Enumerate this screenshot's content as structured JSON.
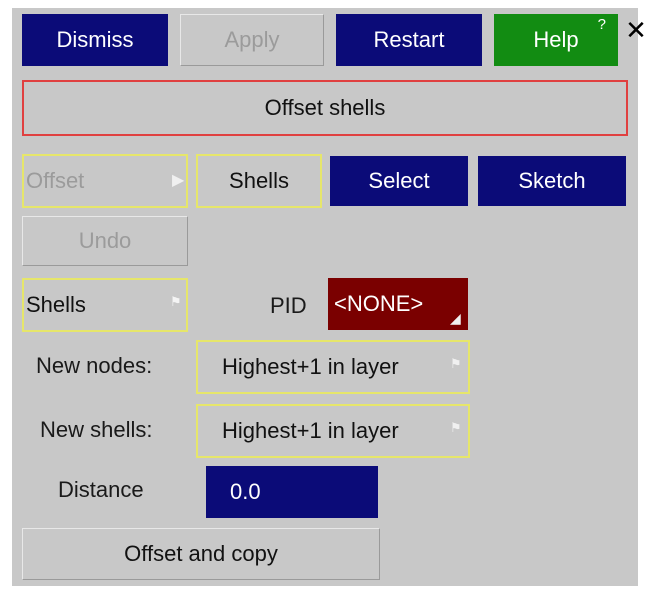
{
  "toolbar": {
    "dismiss": "Dismiss",
    "apply": "Apply",
    "restart": "Restart",
    "help": "Help",
    "help_badge": "?",
    "close": "✕"
  },
  "title": "Offset shells",
  "mode_row": {
    "offset": "Offset",
    "shells": "Shells",
    "select": "Select",
    "sketch": "Sketch"
  },
  "undo": "Undo",
  "shells_row": {
    "shells": "Shells",
    "pid_label": "PID",
    "pid_value": "<NONE>"
  },
  "new_nodes": {
    "label": "New nodes:",
    "value": "Highest+1 in layer"
  },
  "new_shells": {
    "label": "New shells:",
    "value": "Highest+1 in layer"
  },
  "distance": {
    "label": "Distance",
    "value": "0.0"
  },
  "offset_copy": "Offset and copy",
  "colors": {
    "navy": "#0b0b78",
    "green": "#128c12",
    "pid_red": "#7a0000",
    "panel": "#c8c8c8",
    "title_border": "#e04040",
    "highlight": "#e6e66a"
  }
}
